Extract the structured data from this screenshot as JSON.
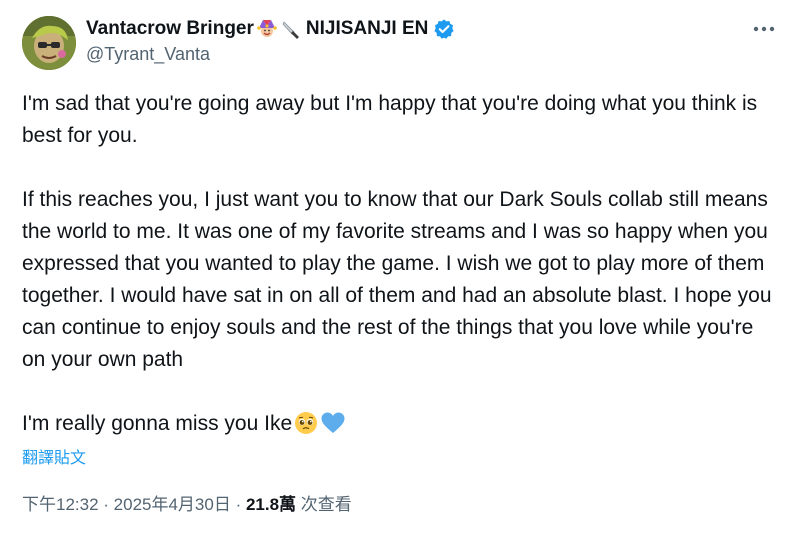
{
  "author": {
    "display_name": "Vantacrow Bringer",
    "name_suffix": "NIJISANJI EN",
    "handle": "@Tyrant_Vanta",
    "name_emojis": [
      "jester-emoji",
      "knife-emoji"
    ],
    "verified": true
  },
  "tweet": {
    "paragraphs": [
      "I'm sad that you're going away but I'm happy that you're doing what you think is best for you.",
      "If this reaches you, I just want you to know that our Dark Souls collab still means the world to me. It was one of my favorite streams and I was so happy when you expressed that you wanted to play the game. I wish we got to play more of them together. I would have sat in on all of them and had an absolute blast. I hope you can continue to enjoy souls and the rest of the things that you love while you're on your own path"
    ],
    "closing": "I'm really gonna miss you Ike",
    "closing_emojis": [
      "pleading-face-emoji",
      "blue-heart-emoji"
    ],
    "translate_label": "翻譯貼文"
  },
  "meta": {
    "time": "下午12:32",
    "separator": " · ",
    "date": "2025年4月30日",
    "views_count": "21.8萬",
    "views_label": " 次查看"
  },
  "colors": {
    "link": "#1d9bf0",
    "secondary": "#536471",
    "primary_text": "#0f1419",
    "verified_badge": "#1d9bf0"
  }
}
